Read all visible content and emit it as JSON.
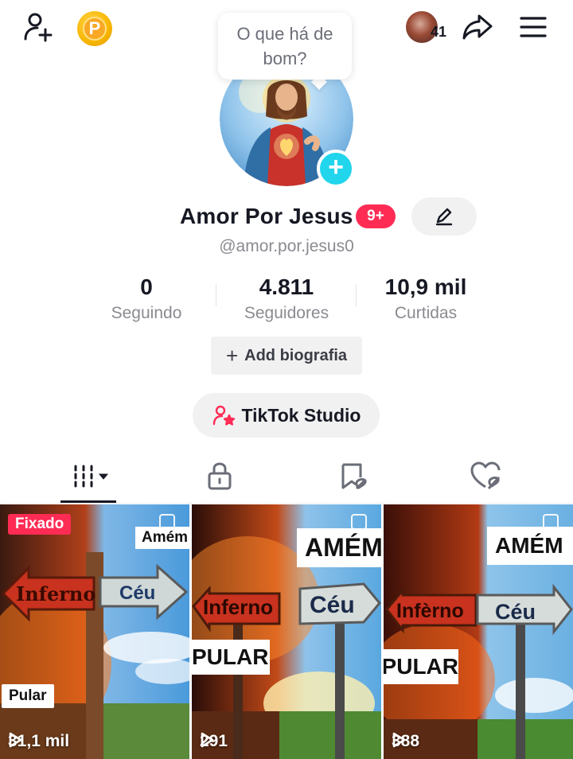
{
  "header": {
    "add_friend_icon": "person-plus-icon",
    "coin_letter": "P",
    "friends_count": "41",
    "share_icon": "share-arrow-icon",
    "menu_icon": "hamburger-icon"
  },
  "bubble": {
    "line1": "O que há de",
    "line2": "bom?"
  },
  "profile": {
    "name": "Amor Por Jesus",
    "badge": "9+",
    "handle": "@amor.por.jesus0"
  },
  "stats": [
    {
      "value": "0",
      "label": "Seguindo"
    },
    {
      "value": "4.811",
      "label": "Seguidores"
    },
    {
      "value": "10,9 mil",
      "label": "Curtidas"
    }
  ],
  "buttons": {
    "bio": "Add biografia",
    "studio": "TikTok Studio"
  },
  "tabs": [
    {
      "icon": "videos-grid-icon"
    },
    {
      "icon": "lock-icon"
    },
    {
      "icon": "favorites-icon"
    },
    {
      "icon": "liked-icon"
    }
  ],
  "videos": [
    {
      "pinned": "Fixado",
      "views": "31,1 mil",
      "label_top": "Amém",
      "label_left": "Inferno",
      "label_right": "Céu",
      "label_bottom": "Pular"
    },
    {
      "views": "291",
      "label_top": "AMÉM",
      "label_left": "Inferno",
      "label_right": "Céu",
      "label_mid": "PULAR"
    },
    {
      "views": "388",
      "label_top": "AMÉM",
      "label_left": "Infèrno",
      "label_right": "Céu",
      "label_mid": "PULAR"
    }
  ],
  "colors": {
    "accent": "#fe2c55",
    "add": "#20d5ec",
    "text": "#161823",
    "muted": "#8a8b91"
  }
}
